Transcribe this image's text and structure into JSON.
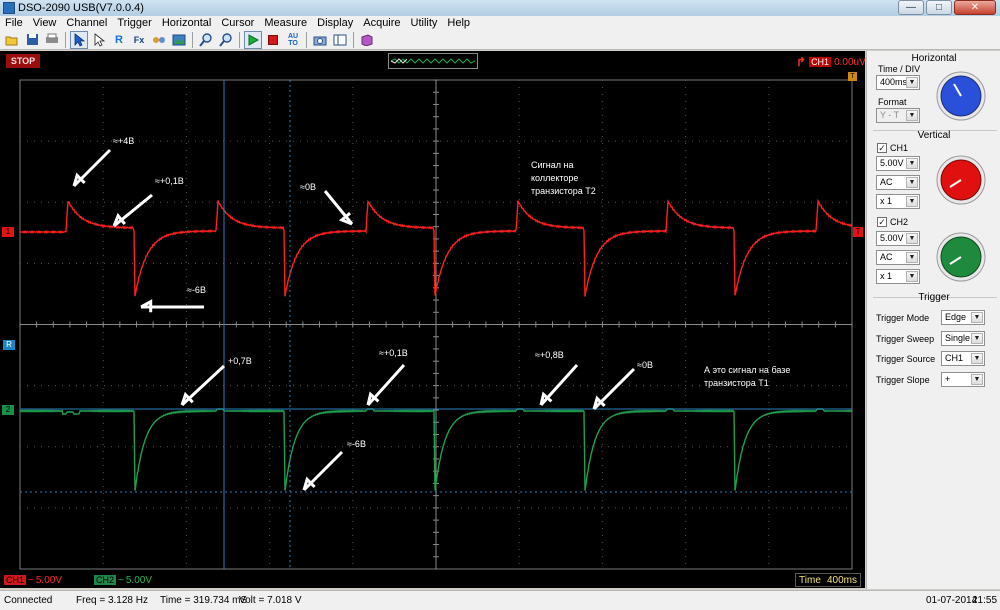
{
  "window": {
    "title": "DSO-2090 USB(V7.0.0.4)",
    "minimize_icon": "minimize-icon",
    "maximize_icon": "maximize-icon",
    "close_icon": "close-icon"
  },
  "menu": [
    "File",
    "View",
    "Channel",
    "Trigger",
    "Horizontal",
    "Cursor",
    "Measure",
    "Display",
    "Acquire",
    "Utility",
    "Help"
  ],
  "toolbar": {
    "icons": [
      "open-icon",
      "save-icon",
      "print-icon",
      "cursor-select-icon",
      "pointer-icon",
      "reference-icon",
      "fft-icon",
      "math-icon",
      "image-icon",
      "zoom-in-icon",
      "zoom-out-icon",
      "run-icon",
      "stop-icon",
      "auto-set-icon",
      "snapshot-icon",
      "display-settings-icon",
      "library-icon"
    ],
    "glyphs": {
      "reference": "R",
      "fft": "Fx",
      "auto": "AU TO"
    }
  },
  "scope_top": {
    "run_state": "STOP",
    "trigger_source": "CH1",
    "trigger_level": "0.00uV",
    "trigger_edge_icon": "rising-edge-icon"
  },
  "screen": {
    "background": "#000000",
    "ch1_color": "#ff2020",
    "ch2_color": "#20a050",
    "cursor_color": "#2a7fbf",
    "ch1_marker": "1",
    "ch2_marker": "2",
    "ref_marker": "R",
    "trig_marker": "T",
    "annotations": {
      "ch1_peak": "≈+4В",
      "ch1_step": "≈+0,1В",
      "ch1_zero": "≈0В",
      "ch1_min": "≈-6В",
      "ch1_caption_line1": "Сигнал на",
      "ch1_caption_line2": "коллекторе",
      "ch1_caption_line3": "транзистора Т2",
      "ch2_a": "+0,7В",
      "ch2_b": "≈+0,1В",
      "ch2_min": "≈-6В",
      "ch2_c": "≈+0,8В",
      "ch2_zero": "≈0В",
      "ch2_caption_line1": "А это сигнал на базе",
      "ch2_caption_line2": "транзистора Т1"
    }
  },
  "scope_bottom": {
    "ch1_badge": "CH1",
    "ch1_coupling": "~",
    "ch1_volts": "5.00V",
    "ch2_badge": "CH2",
    "ch2_coupling": "~",
    "ch2_volts": "5.00V",
    "time_label": "Time",
    "time_value": "400ms"
  },
  "statusbar": {
    "state": "Connected",
    "freq": "Freq = 3.128 Hz",
    "time": "Time = 319.734 mS",
    "volt": "Volt = 7.018 V",
    "date": "01-07-2014",
    "clock": "21:55"
  },
  "panel": {
    "horizontal_title": "Horizontal",
    "time_div_label": "Time / DIV",
    "time_div_value": "400ms",
    "format_label": "Format",
    "format_value": "Y - T",
    "vertical_title": "Vertical",
    "ch1_label": "CH1",
    "ch1_volts": "5.00V",
    "ch1_coupling": "AC",
    "ch1_probe": "x 1",
    "ch2_label": "CH2",
    "ch2_volts": "5.00V",
    "ch2_coupling": "AC",
    "ch2_probe": "x 1",
    "trigger_title": "Trigger",
    "trigger_mode_label": "Trigger Mode",
    "trigger_mode_value": "Edge",
    "trigger_sweep_label": "Trigger Sweep",
    "trigger_sweep_value": "Single",
    "trigger_source_label": "Trigger Source",
    "trigger_source_value": "CH1",
    "trigger_slope_label": "Trigger Slope",
    "trigger_slope_value": "+",
    "knob_colors": {
      "horizontal": "#2a4fd8",
      "ch1": "#e01010",
      "ch2": "#1f8a3e"
    }
  }
}
